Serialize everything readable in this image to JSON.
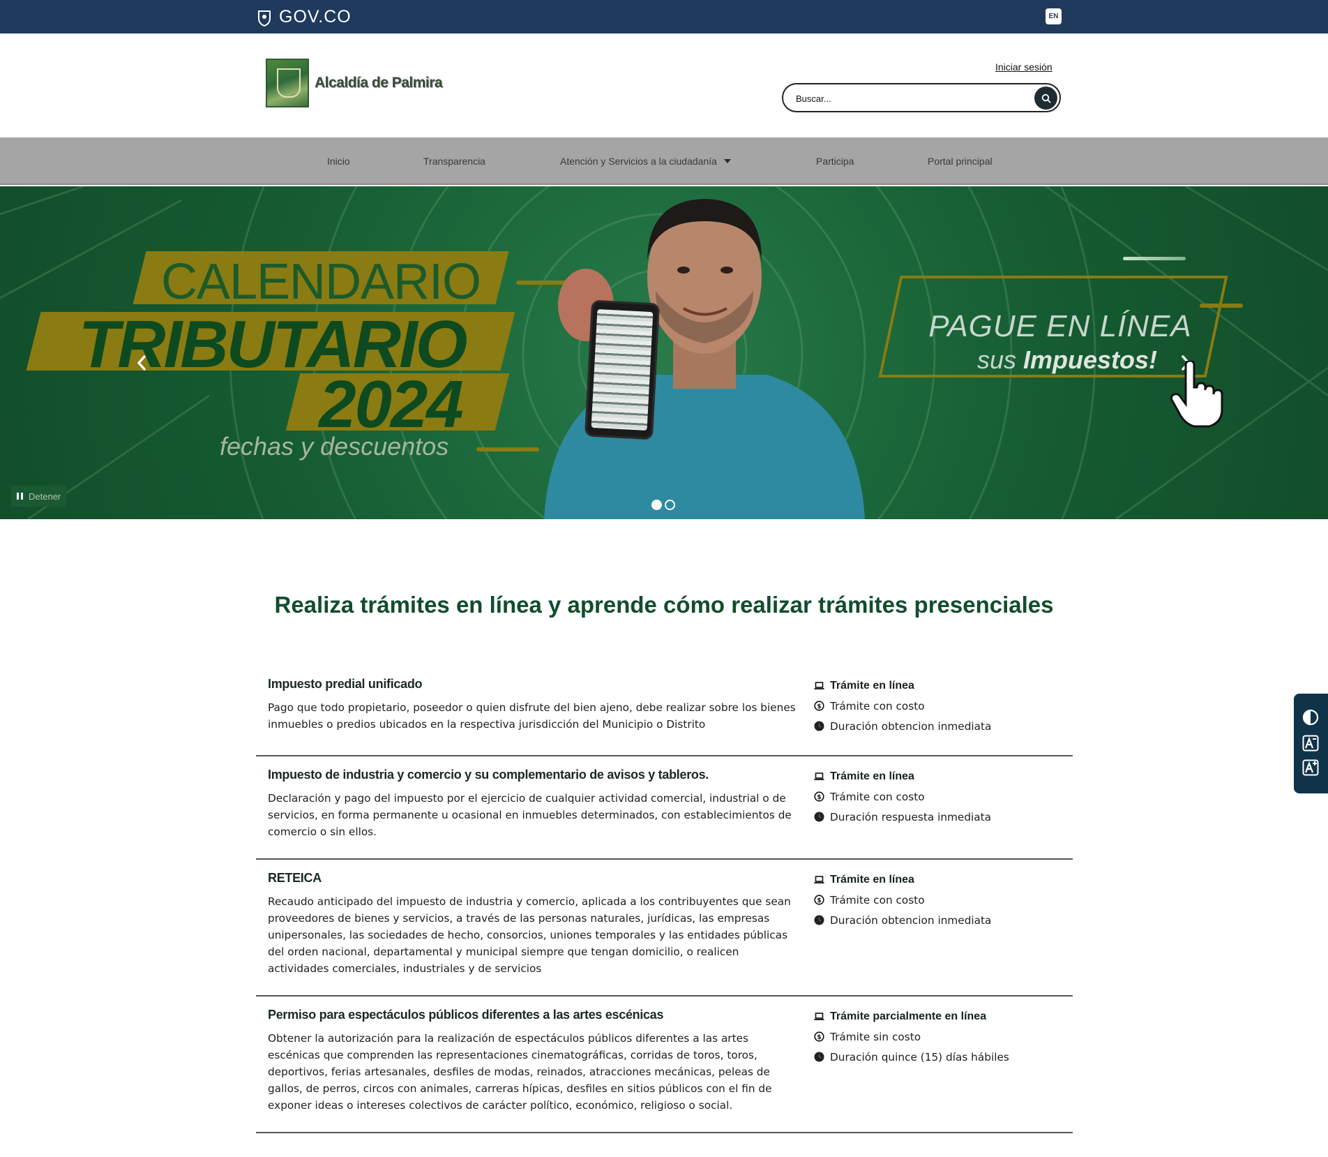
{
  "govbar": {
    "logo_text": "GOV.CO",
    "lang_button": "EN"
  },
  "header": {
    "brand_name": "Alcaldía de Palmira",
    "login_link": "Iniciar sesión",
    "search_placeholder": "Buscar..."
  },
  "nav": {
    "items": [
      {
        "label": "Inicio"
      },
      {
        "label": "Transparencia"
      },
      {
        "label": "Atención y Servicios a la ciudadanía"
      },
      {
        "label": "Participa"
      },
      {
        "label": "Portal principal"
      }
    ]
  },
  "banner": {
    "line1": "CALENDARIO",
    "line2": "TRIBUTARIO",
    "line3": "2024",
    "line4": "fechas y descuentos",
    "pay_line1": "PAGUE EN LÍNEA",
    "pay_line2_prefix": "sus",
    "pay_line2_bold": "Impuestos!",
    "stop_label": "Detener",
    "slide_count": 2,
    "active_slide": 1
  },
  "main": {
    "title": "Realiza trámites en línea y aprende cómo realizar trámites presenciales",
    "procedures": [
      {
        "title": "Impuesto predial unificado",
        "description": "Pago que todo propietario, poseedor o quien disfrute del bien ajeno, debe realizar sobre los bienes inmuebles o predios ubicados en la respectiva jurisdicción del Municipio o Distrito",
        "mode": "Trámite en línea",
        "cost": "Trámite con costo",
        "duration": "Duración obtencion inmediata"
      },
      {
        "title": "Impuesto de industria y comercio y su complementario de avisos y tableros.",
        "description": "Declaración y pago del impuesto por el ejercicio de cualquier actividad comercial, industrial o de servicios, en forma permanente u ocasional en inmuebles determinados, con establecimientos de comercio o sin ellos.",
        "mode": "Trámite en línea",
        "cost": "Trámite con costo",
        "duration": "Duración respuesta inmediata"
      },
      {
        "title": "RETEICA",
        "description": "Recaudo anticipado del impuesto de industria y comercio, aplicada a los contribuyentes que sean proveedores de bienes y servicios, a través de las personas naturales, jurídicas, las empresas unipersonales, las sociedades de hecho, consorcios, uniones temporales y las entidades públicas del orden nacional, departamental y municipal siempre que tengan domicilio, o realicen actividades comerciales, industriales y de servicios",
        "mode": "Trámite en línea",
        "cost": "Trámite con costo",
        "duration": "Duración obtencion inmediata"
      },
      {
        "title": "Permiso para espectáculos públicos diferentes a las artes escénicas",
        "description": "Obtener la autorización  para la realización de espectáculos públicos diferentes a las artes escénicas que comprenden las representaciones cinematográficas, corridas de toros, toros, deportivos, ferias artesanales, desfiles de modas, reinados, atracciones mecánicas, peleas de gallos, de perros, circos con animales, carreras hípicas, desfiles en sitios públicos con el fin de exponer ideas o intereses colectivos de carácter político, económico, religioso o social.",
        "mode": "Trámite parcialmente en línea",
        "cost": "Trámite sin costo",
        "duration": "Duración quince (15) días hábiles"
      }
    ]
  },
  "accessibility": {
    "contrast_icon": "contrast-icon",
    "decrease_font_icon": "font-decrease-icon",
    "increase_font_icon": "font-increase-icon"
  },
  "colors": {
    "govbar": "#1f3a5c",
    "nav": "#a5a5a5",
    "banner_green": "#155a31",
    "banner_gold": "#8a7b12",
    "title_green": "#114d2e",
    "a11y_bar": "#0f3349"
  }
}
